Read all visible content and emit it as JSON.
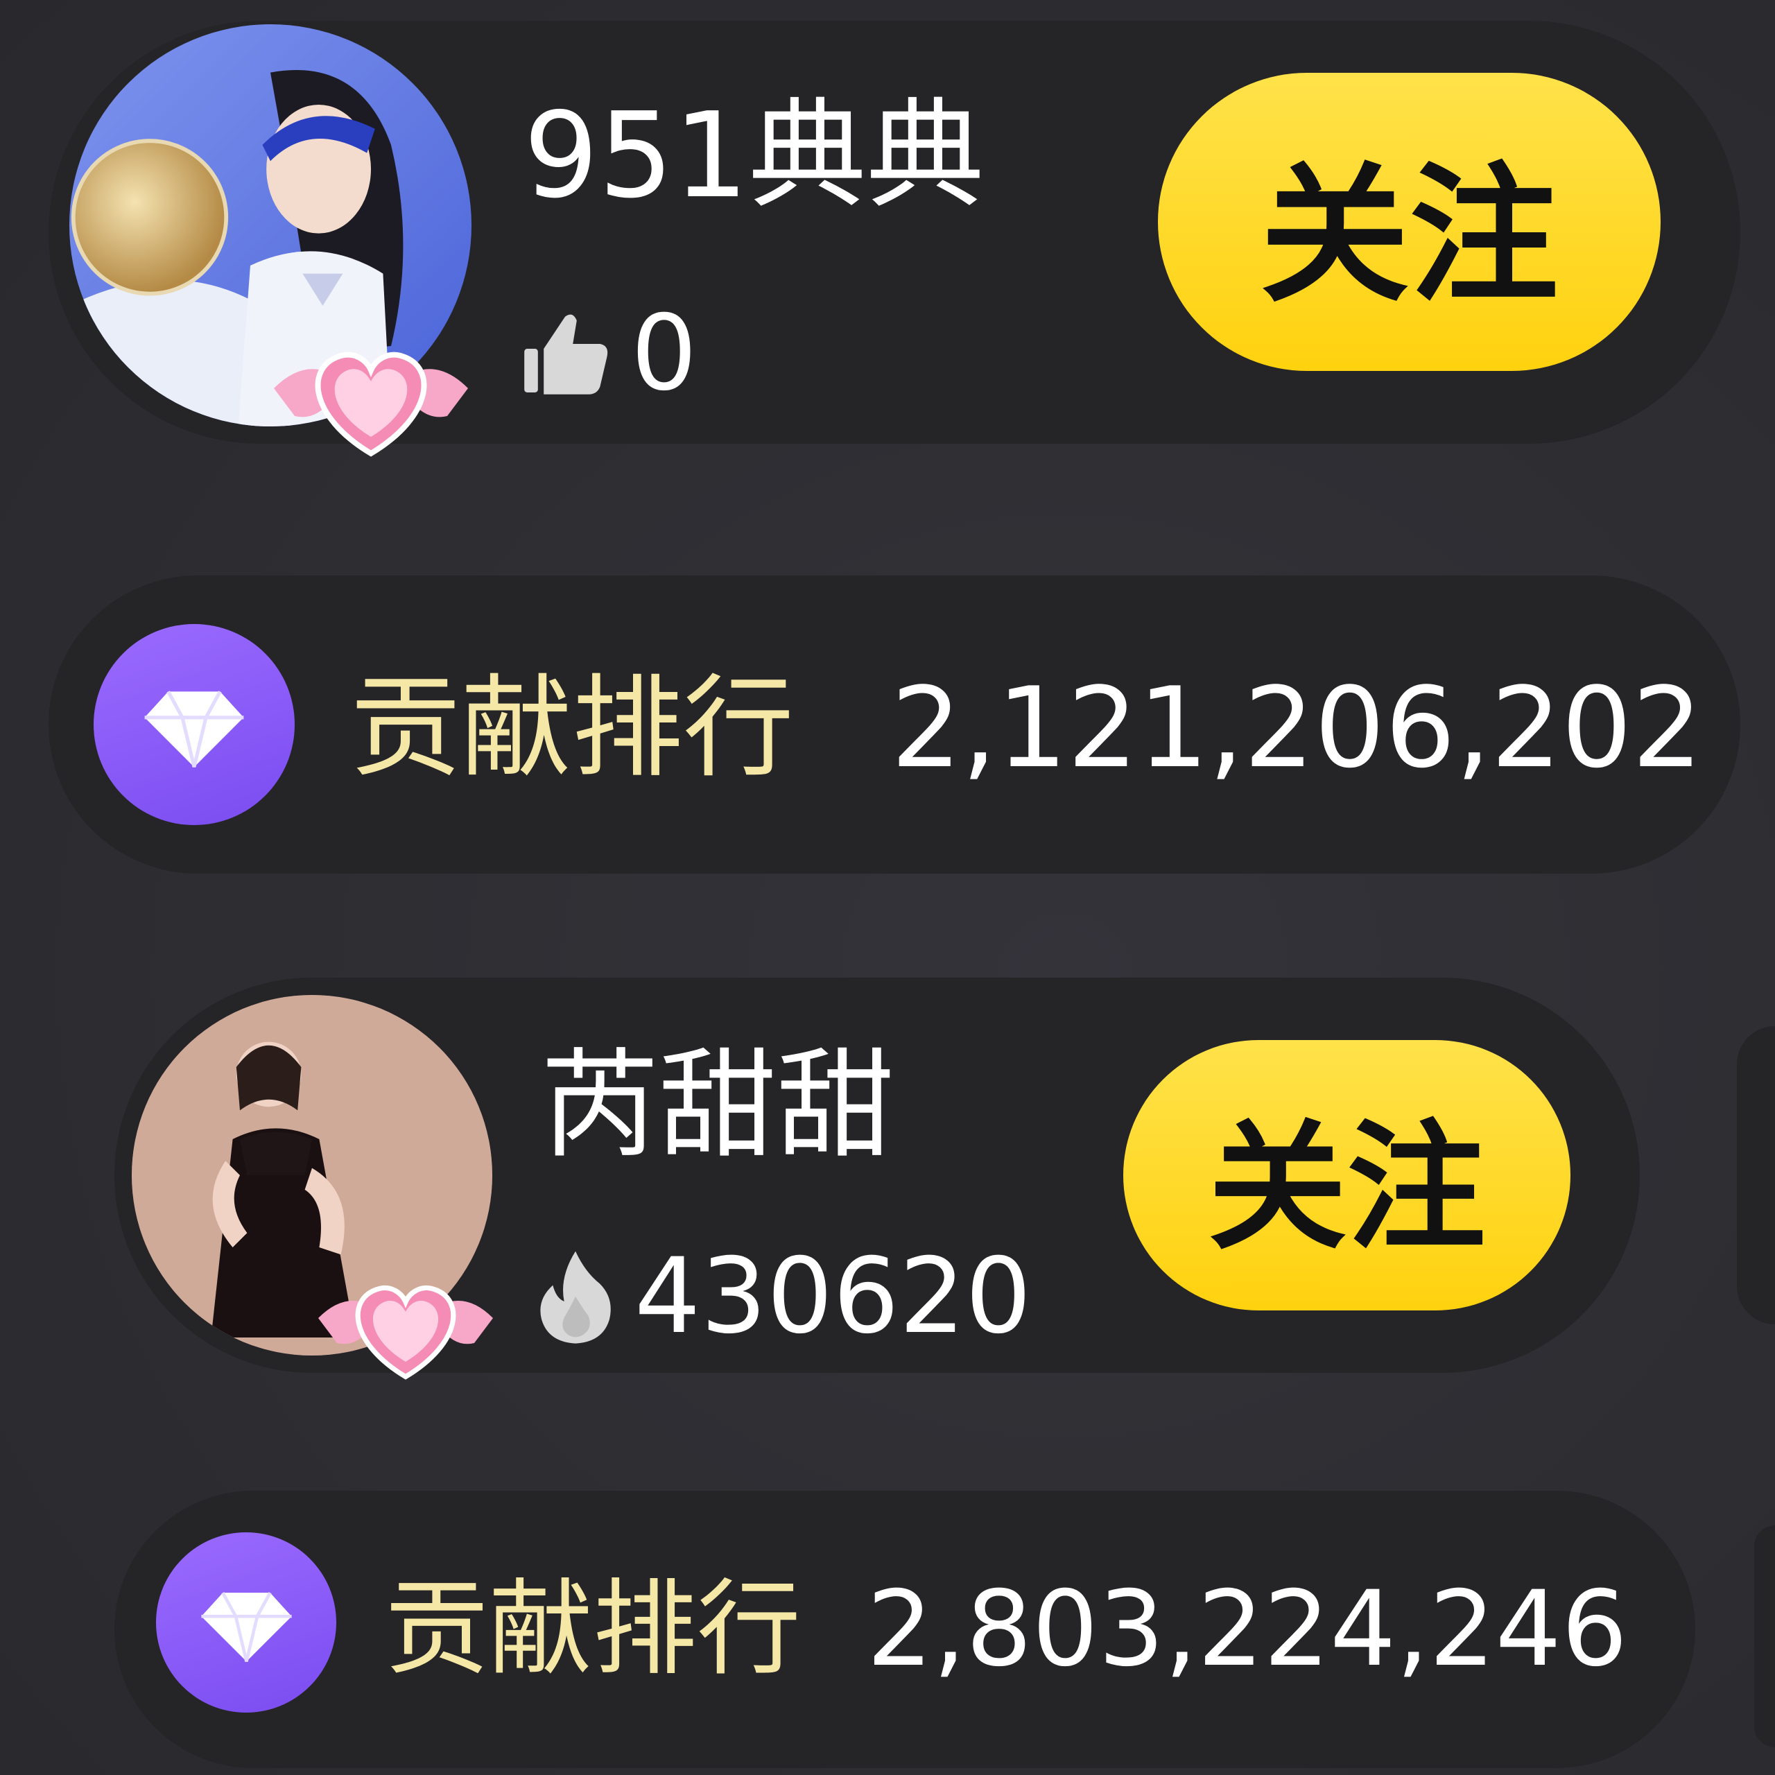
{
  "streamers": [
    {
      "name": "951典典",
      "stat_icon": "thumbs-up-icon",
      "stat_value": "0",
      "follow_label": "关注",
      "rank_icon": "diamond-icon",
      "rank_label": "贡献排行",
      "rank_value": "2,121,206,202"
    },
    {
      "name": "芮甜甜",
      "stat_icon": "flame-icon",
      "stat_value": "430620",
      "follow_label": "关注",
      "rank_icon": "diamond-icon",
      "rank_label": "贡献排行",
      "rank_value": "2,803,224,246"
    }
  ],
  "colors": {
    "follow_button": "#ffd20f",
    "rank_label": "#f5e7a6",
    "diamond_badge": "#8a5cf6",
    "card_background": "#252528"
  }
}
